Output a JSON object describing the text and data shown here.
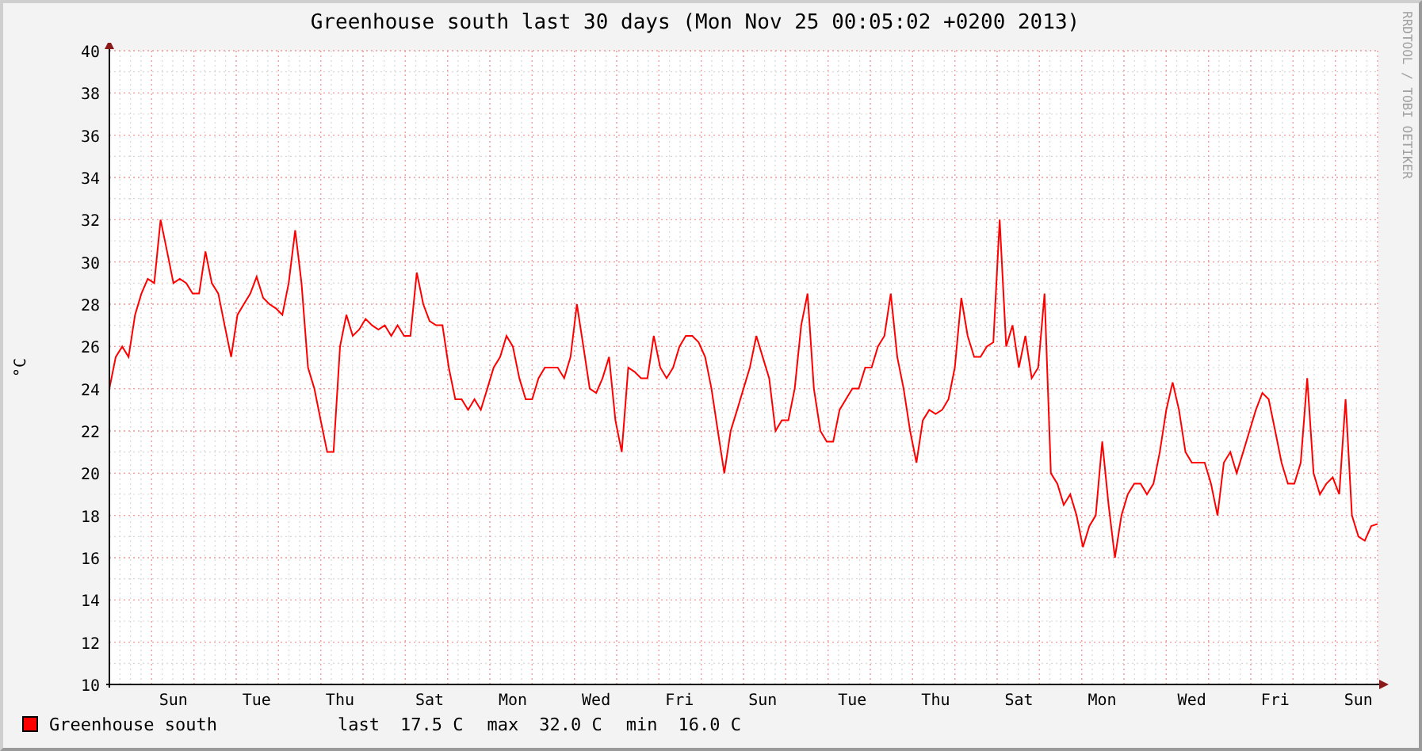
{
  "chart_title": "Greenhouse south last 30 days (Mon Nov 25 00:05:02 +0200 2013)",
  "watermark": "RRDTOOL / TOBI OETIKER",
  "chart_data": {
    "type": "line",
    "grid": true,
    "ylabel": "°C",
    "ylim": [
      10,
      40
    ],
    "yticks": [
      10,
      12,
      14,
      16,
      18,
      20,
      22,
      24,
      26,
      28,
      30,
      32,
      34,
      36,
      38,
      40
    ],
    "categories": [
      null,
      null,
      null,
      null,
      null,
      null,
      null,
      null,
      null,
      null,
      "Sun",
      null,
      null,
      null,
      null,
      null,
      null,
      null,
      null,
      null,
      null,
      null,
      null,
      "Tue",
      null,
      null,
      null,
      null,
      null,
      null,
      null,
      null,
      null,
      null,
      null,
      null,
      "Thu",
      null,
      null,
      null,
      null,
      null,
      null,
      null,
      null,
      null,
      null,
      null,
      null,
      null,
      "Sat",
      null,
      null,
      null,
      null,
      null,
      null,
      null,
      null,
      null,
      null,
      null,
      null,
      "Mon",
      null,
      null,
      null,
      null,
      null,
      null,
      null,
      null,
      null,
      null,
      null,
      null,
      "Wed",
      null,
      null,
      null,
      null,
      null,
      null,
      null,
      null,
      null,
      null,
      null,
      null,
      "Fri",
      null,
      null,
      null,
      null,
      null,
      null,
      null,
      null,
      null,
      null,
      null,
      null,
      "Sun",
      null,
      null,
      null,
      null,
      null,
      null,
      null,
      null,
      null,
      null,
      null,
      null,
      null,
      "Tue",
      null,
      null,
      null,
      null,
      null,
      null,
      null,
      null,
      null,
      null,
      null,
      null,
      "Thu",
      null,
      null,
      null,
      null,
      null,
      null,
      null,
      null,
      null,
      null,
      null,
      null,
      "Sat",
      null,
      null,
      null,
      null,
      null,
      null,
      null,
      null,
      null,
      null,
      null,
      null,
      "Mon",
      null,
      null,
      null,
      null,
      null,
      null,
      null,
      null,
      null,
      null,
      null,
      null,
      null,
      "Wed",
      null,
      null,
      null,
      null,
      null,
      null,
      null,
      null,
      null,
      null,
      null,
      null,
      "Fri",
      null,
      null,
      null,
      null,
      null,
      null,
      null,
      null,
      null,
      null,
      null,
      null,
      "Sun",
      null,
      null,
      null
    ],
    "series": [
      {
        "name": "Greenhouse south",
        "color": "#ff0000",
        "values": [
          24,
          25.5,
          26,
          25.5,
          27.5,
          28.5,
          29.2,
          29,
          32,
          30.5,
          29,
          29.2,
          29,
          28.5,
          28.5,
          30.5,
          29,
          28.5,
          27,
          25.5,
          27.5,
          28,
          28.5,
          29.3,
          28.3,
          28,
          27.8,
          27.5,
          29,
          31.5,
          29,
          25,
          24,
          22.5,
          21,
          21,
          26,
          27.5,
          26.5,
          26.8,
          27.3,
          27,
          26.8,
          27,
          26.5,
          27,
          26.5,
          26.5,
          29.5,
          28,
          27.2,
          27,
          27,
          25,
          23.5,
          23.5,
          23,
          23.5,
          23,
          24,
          25,
          25.5,
          26.5,
          26,
          24.5,
          23.5,
          23.5,
          24.5,
          25,
          25,
          25,
          24.5,
          25.5,
          28,
          26,
          24,
          23.8,
          24.5,
          25.5,
          22.5,
          21,
          25,
          24.8,
          24.5,
          24.5,
          26.5,
          25,
          24.5,
          25,
          26,
          26.5,
          26.5,
          26.2,
          25.5,
          24,
          22,
          20,
          22,
          23,
          24,
          25,
          26.5,
          25.5,
          24.5,
          22,
          22.5,
          22.5,
          24,
          27,
          28.5,
          24,
          22,
          21.5,
          21.5,
          23,
          23.5,
          24,
          24,
          25,
          25,
          26,
          26.5,
          28.5,
          25.5,
          24,
          22,
          20.5,
          22.5,
          23,
          22.8,
          23,
          23.5,
          25,
          28.3,
          26.5,
          25.5,
          25.5,
          26,
          26.2,
          32,
          26,
          27,
          25,
          26.5,
          24.5,
          25,
          28.5,
          20,
          19.5,
          18.5,
          19,
          18,
          16.5,
          17.5,
          18,
          21.5,
          18.5,
          16,
          18,
          19,
          19.5,
          19.5,
          19,
          19.5,
          21,
          23,
          24.3,
          23,
          21,
          20.5,
          20.5,
          20.5,
          19.5,
          18,
          20.5,
          21,
          20,
          21,
          22,
          23,
          23.8,
          23.5,
          22,
          20.5,
          19.5,
          19.5,
          20.5,
          24.5,
          20,
          19,
          19.5,
          19.8,
          19,
          23.5,
          18,
          17,
          16.8,
          17.5,
          17.6
        ]
      }
    ]
  },
  "legend": {
    "stats": [
      {
        "label": "last",
        "value": "17.5 C"
      },
      {
        "label": "max",
        "value": "32.0 C"
      },
      {
        "label": "min",
        "value": "16.0 C"
      }
    ]
  }
}
